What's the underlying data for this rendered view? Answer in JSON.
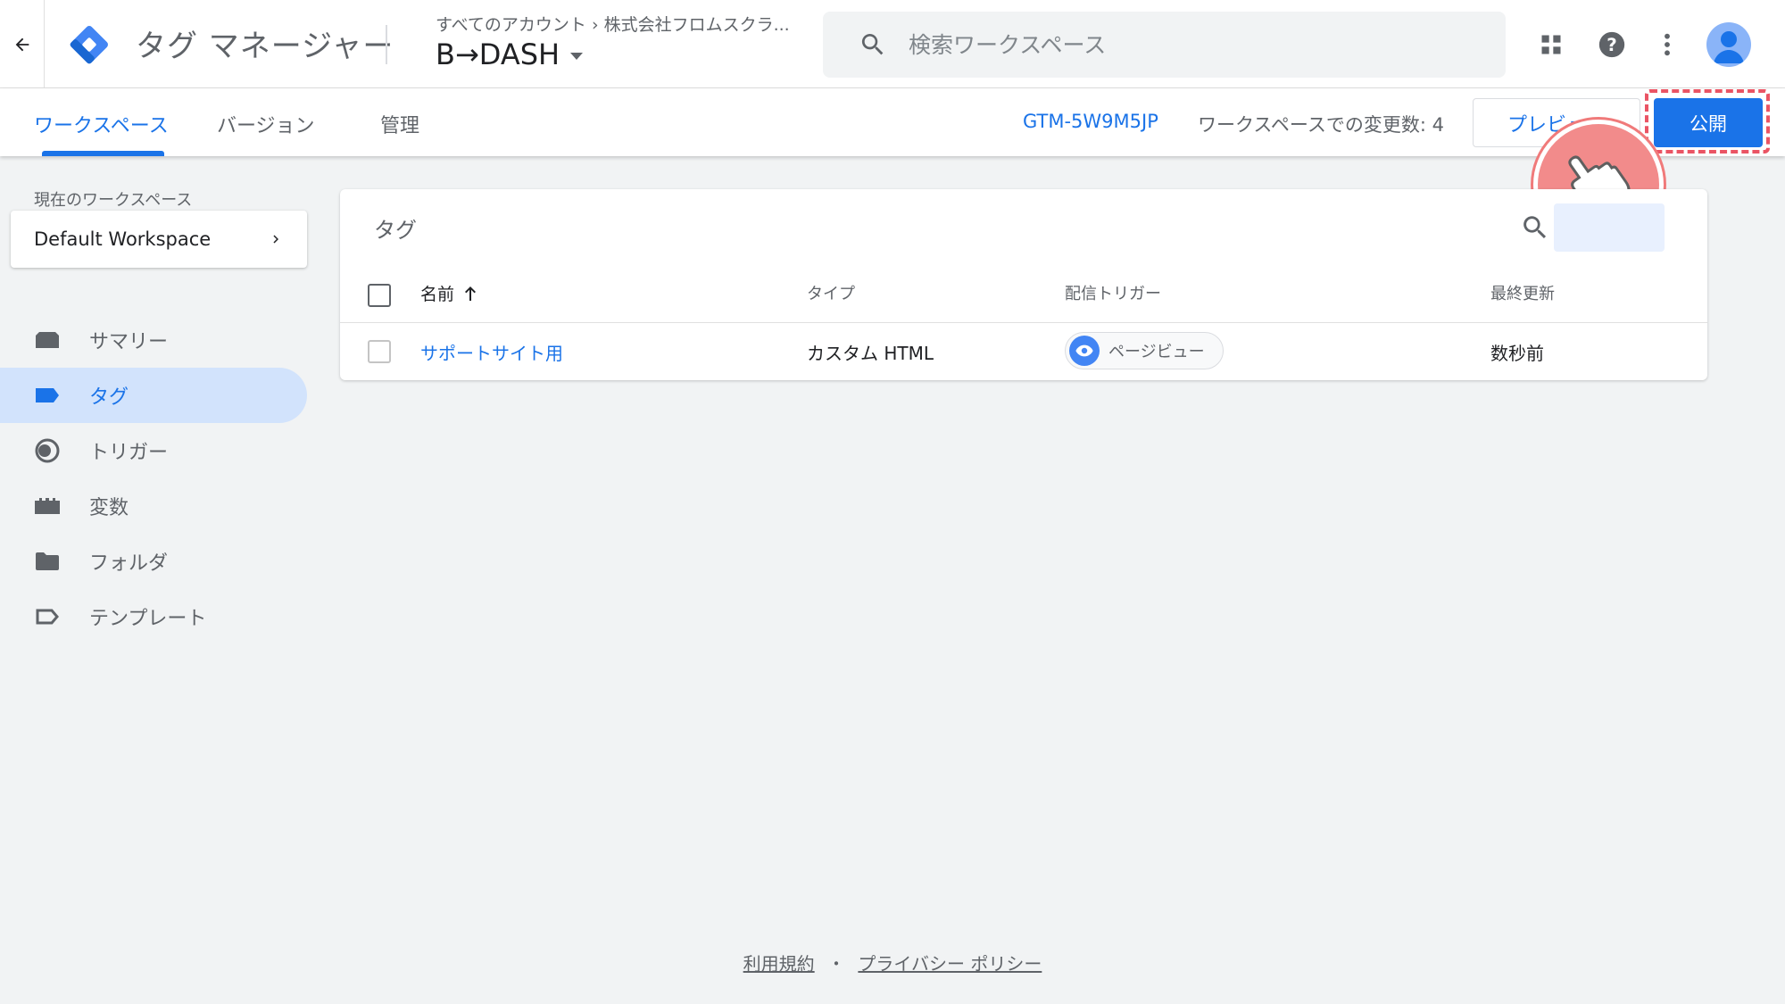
{
  "app": {
    "title": "タグ マネージャー"
  },
  "header": {
    "breadcrumb": "すべてのアカウント › 株式会社フロムスクラ...",
    "container_name": "B→DASH",
    "search_placeholder": "検索ワークスペース"
  },
  "subnav": {
    "tabs": [
      {
        "label": "ワークスペース"
      },
      {
        "label": "バージョン"
      },
      {
        "label": "管理"
      }
    ],
    "container_id": "GTM-5W9M5JP",
    "changes_text": "ワークスペースでの変更数: 4",
    "preview_label": "プレビュー",
    "publish_label": "公開"
  },
  "sidebar": {
    "workspace_label": "現在のワークスペース",
    "workspace_name": "Default Workspace",
    "items": [
      {
        "label": "サマリー",
        "icon": "summary-icon"
      },
      {
        "label": "タグ",
        "icon": "tag-icon"
      },
      {
        "label": "トリガー",
        "icon": "trigger-icon"
      },
      {
        "label": "変数",
        "icon": "variables-icon"
      },
      {
        "label": "フォルダ",
        "icon": "folder-icon"
      },
      {
        "label": "テンプレート",
        "icon": "template-icon"
      }
    ]
  },
  "tags_table": {
    "title": "タグ",
    "columns": {
      "name": "名前",
      "type": "タイプ",
      "trigger": "配信トリガー",
      "updated": "最終更新"
    },
    "rows": [
      {
        "name": "サポートサイト用",
        "type": "カスタム HTML",
        "trigger": "ページビュー",
        "updated": "数秒前"
      }
    ]
  },
  "footer": {
    "terms": "利用規約",
    "separator": "・",
    "privacy": "プライバシー ポリシー"
  },
  "colors": {
    "accent": "#1a73e8",
    "highlight": "#ea5464"
  }
}
